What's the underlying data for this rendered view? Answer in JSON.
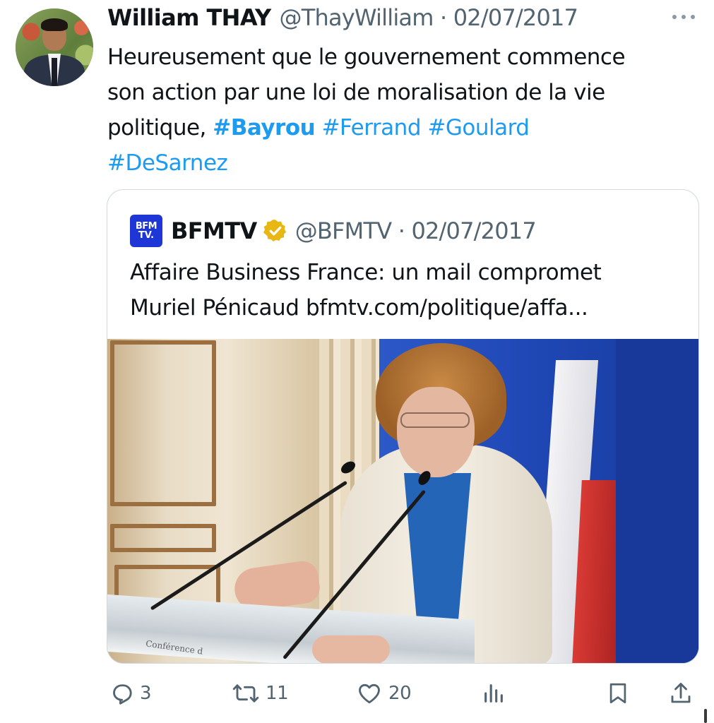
{
  "author": {
    "name": "William THAY",
    "handle": "@ThayWilliam",
    "separator": "·",
    "date": "02/07/2017"
  },
  "tweet": {
    "text_lines": [
      "Heureusement que le gouvernement commence",
      "son action par une loi de moralisation de la vie",
      "politique,"
    ],
    "hashtags": [
      "#Bayrou",
      "#Ferrand",
      "#Goulard",
      "#DeSarnez"
    ]
  },
  "quote": {
    "logo_text_top": "BFM",
    "logo_text_bottom": "TV.",
    "name": "BFMTV",
    "handle": "@BFMTV",
    "separator": "·",
    "date": "02/07/2017",
    "text_line1": "Affaire Business France: un mail compromet",
    "text_line2": "Muriel Pénicaud bfmtv.com/politique/affa...",
    "podium_text": "Conférence d"
  },
  "actions": {
    "replies": "3",
    "retweets": "11",
    "likes": "20"
  },
  "icons": {
    "more": "more-icon",
    "verified": "verified-badge-icon",
    "reply": "reply-icon",
    "retweet": "retweet-icon",
    "like": "heart-icon",
    "views": "views-icon",
    "bookmark": "bookmark-icon",
    "share": "share-icon"
  },
  "colors": {
    "link": "#1d9bf0",
    "secondary_text": "#536471",
    "verified_gold": "#e8b714",
    "bfm_blue": "#1f36d6"
  }
}
